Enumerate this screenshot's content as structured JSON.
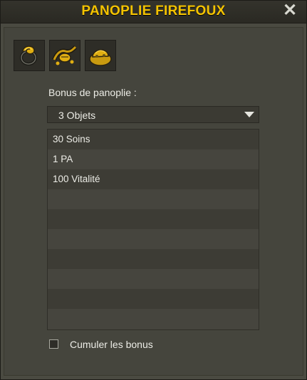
{
  "window": {
    "title": "PANOPLIE FIREFOUX",
    "close_icon": "close-icon"
  },
  "items": [
    {
      "icon": "ring-item-icon"
    },
    {
      "icon": "belt-item-icon"
    },
    {
      "icon": "hat-item-icon"
    }
  ],
  "bonus": {
    "label": "Bonus de panoplie :",
    "selected": "3 Objets",
    "rows": [
      "30 Soins",
      "1 PA",
      "100 Vitalité",
      "",
      "",
      "",
      "",
      "",
      "",
      ""
    ]
  },
  "cumulate": {
    "label": "Cumuler les bonus",
    "checked": false
  },
  "colors": {
    "title": "#f4c300",
    "background": "#4a4a41",
    "gold": "#e0ae12"
  }
}
